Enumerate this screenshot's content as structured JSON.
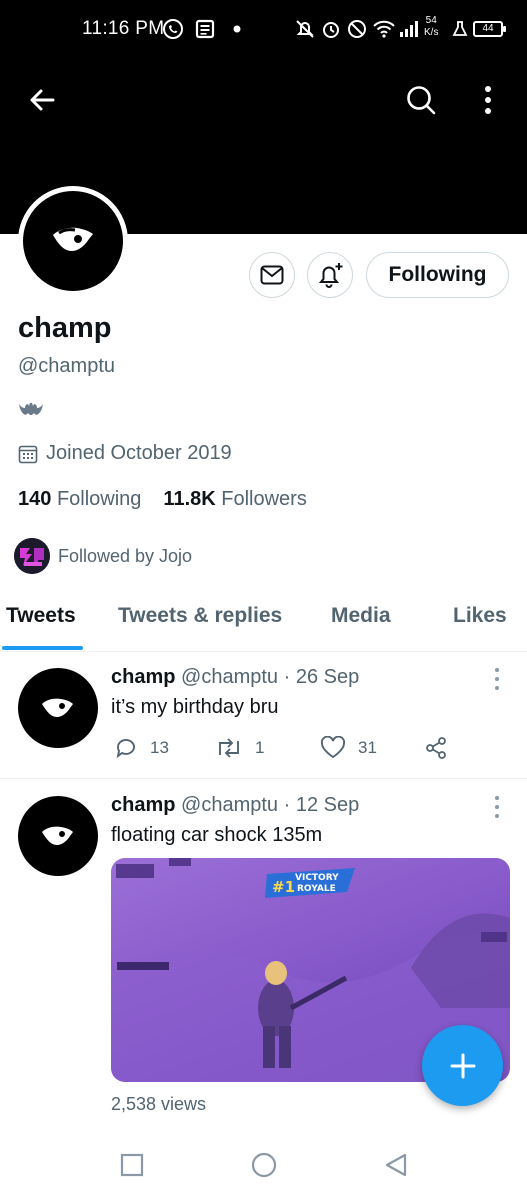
{
  "status_bar": {
    "time": "11:16 PM",
    "net_speed_value": "54",
    "net_speed_unit": "K/s",
    "battery": "44"
  },
  "header": {
    "back_icon": "arrow-left-icon",
    "search_icon": "search-icon",
    "more_icon": "more-vertical-icon"
  },
  "profile": {
    "name": "champ",
    "handle": "@champtu",
    "bio_emoji": "bat-emoji",
    "joined": "Joined October 2019",
    "following_count": "140",
    "following_label": "Following",
    "followers_count": "11.8K",
    "followers_label": "Followers",
    "followed_by": "Followed by Jojo",
    "follow_button_label": "Following"
  },
  "tabs": [
    {
      "label": "Tweets",
      "active": true
    },
    {
      "label": "Tweets & replies",
      "active": false
    },
    {
      "label": "Media",
      "active": false
    },
    {
      "label": "Likes",
      "active": false
    }
  ],
  "tweets": [
    {
      "name": "champ",
      "meta": "@champtu · 26 Sep",
      "text": "it’s my birthday bru",
      "replies": "13",
      "retweets": "1",
      "likes": "31"
    },
    {
      "name": "champ",
      "meta": "@champtu · 12 Sep",
      "text": "floating car shock 135m",
      "media_label_1": "#1",
      "media_label_2": "VICTORY",
      "media_label_3": "ROYALE",
      "views": "2,538 views"
    }
  ],
  "colors": {
    "accent": "#1d9bf0",
    "muted": "#536471",
    "border": "#cfd9de"
  }
}
